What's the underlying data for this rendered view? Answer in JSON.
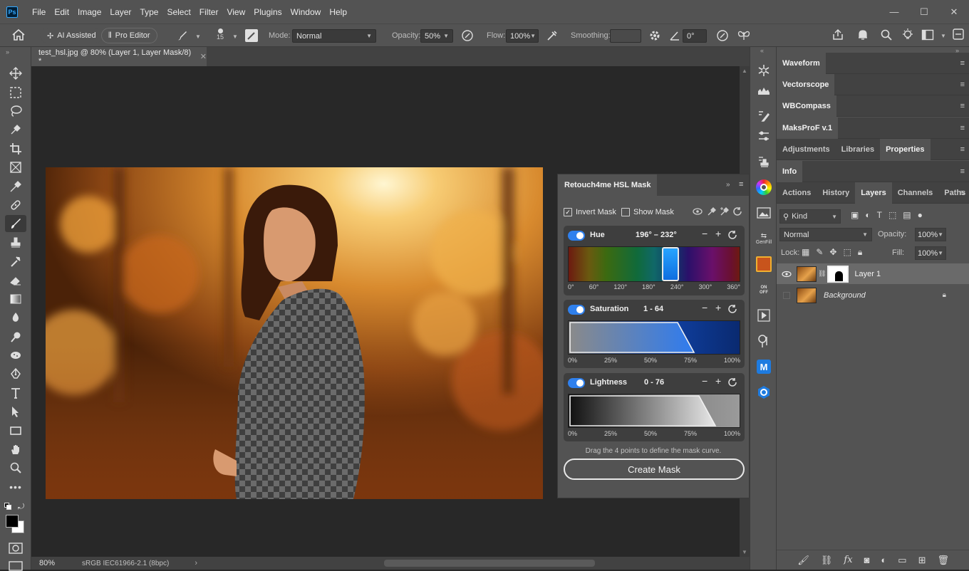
{
  "app": {
    "logo": "Ps"
  },
  "menu": [
    "File",
    "Edit",
    "Image",
    "Layer",
    "Type",
    "Select",
    "Filter",
    "View",
    "Plugins",
    "Window",
    "Help"
  ],
  "options": {
    "ai_assisted": "AI Assisted",
    "pro_editor": "Pro Editor",
    "brush_size": "15",
    "mode_label": "Mode:",
    "mode_value": "Normal",
    "opacity_label": "Opacity:",
    "opacity_value": "50%",
    "flow_label": "Flow:",
    "flow_value": "100%",
    "smoothing_label": "Smoothing:",
    "smoothing_value": "",
    "angle_value": "0°"
  },
  "document": {
    "tab_title": "test_hsl.jpg @ 80% (Layer 1, Layer Mask/8) *",
    "zoom": "80%",
    "color_profile": "sRGB IEC61966-2.1 (8bpc)"
  },
  "hsl_panel": {
    "title": "Retouch4me HSL Mask",
    "invert_mask": "Invert Mask",
    "invert_checked": true,
    "show_mask": "Show Mask",
    "show_checked": false,
    "hue": {
      "label": "Hue",
      "range": "196° – 232°",
      "ticks": [
        "0°",
        "60°",
        "120°",
        "180°",
        "240°",
        "300°",
        "360°"
      ],
      "selected_from": 196,
      "selected_to": 232
    },
    "saturation": {
      "label": "Saturation",
      "range": "1 - 64",
      "ticks": [
        "0%",
        "25%",
        "50%",
        "75%",
        "100%"
      ]
    },
    "lightness": {
      "label": "Lightness",
      "range": "0 - 76",
      "ticks": [
        "0%",
        "25%",
        "50%",
        "75%",
        "100%"
      ]
    },
    "hint": "Drag the 4 points to define the mask curve.",
    "create_button": "Create Mask"
  },
  "right_panels": {
    "waveform": "Waveform",
    "vectorscope": "Vectorscope",
    "wbcompass": "WBCompass",
    "maksprof": "MaksProF v.1",
    "tabs1": [
      "Adjustments",
      "Libraries",
      "Properties"
    ],
    "info": "Info",
    "tabs2": [
      "Actions",
      "History",
      "Layers",
      "Channels",
      "Paths"
    ],
    "kind_label": "Kind",
    "blend_mode": "Normal",
    "opacity_label": "Opacity:",
    "opacity_value": "100%",
    "lock_label": "Lock:",
    "fill_label": "Fill:",
    "fill_value": "100%",
    "layers": [
      {
        "name": "Layer 1",
        "selected": true
      },
      {
        "name": "Background",
        "selected": false
      }
    ]
  },
  "icon_column": {
    "genfill_label": "GenFill",
    "on_label": "ON",
    "off_label": "OFF"
  }
}
